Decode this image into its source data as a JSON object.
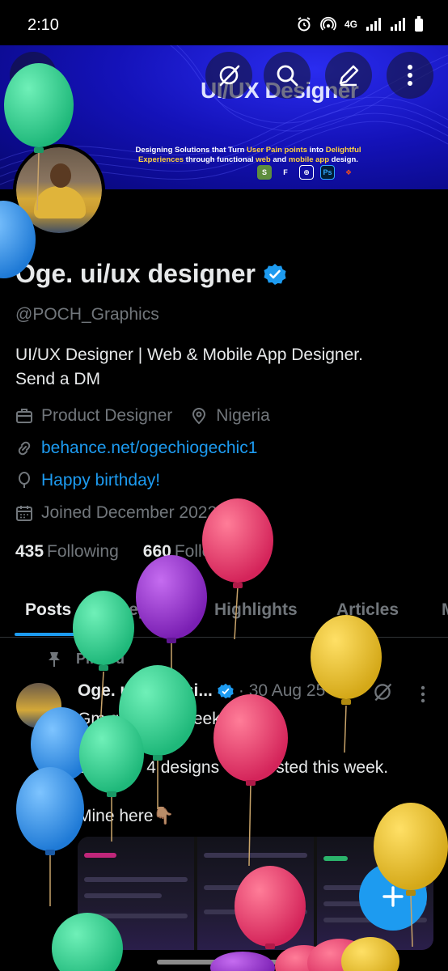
{
  "status_bar": {
    "time": "2:10",
    "network": "4G"
  },
  "banner": {
    "title": "UI/UX Designer",
    "subtitle_parts": [
      "Designing Solutions that Turn ",
      "User Pain points",
      " into ",
      "Delightful Experiences",
      " through functional ",
      "web",
      " and ",
      "mobile app",
      " design."
    ],
    "tools": [
      "Shopify",
      "Framer",
      "Fig",
      "Ps",
      "Figma"
    ],
    "tool_colors": [
      "#5e8e3e",
      "#ffffff",
      "#ffffff",
      "#31a8ff",
      "#f24e1e"
    ]
  },
  "profile": {
    "name": "Oge. ui/ux designer",
    "handle": "@POCH_Graphics",
    "bio_line1": "UI/UX Designer | Web & Mobile App Designer.",
    "bio_line2": "Send a DM",
    "category": "Product Designer",
    "location": "Nigeria",
    "website": "behance.net/ogechiogechic1",
    "birthday": "Happy birthday!",
    "joined": "Joined December 2022",
    "following_count": "435",
    "following_label": "Following",
    "followers_count": "660",
    "followers_label": "Followers"
  },
  "tabs": [
    "Posts",
    "Replies",
    "Highlights",
    "Articles"
  ],
  "active_tab": "Posts",
  "post": {
    "pinned_label": "Pinned",
    "author": "Oge. ui/ux desi...",
    "date": "· 30 Aug 25",
    "line1": "Gm guys, It's weekend.",
    "line2": "Lets see 4 designs You posted this week.",
    "line3": "Mine here👇🏽"
  },
  "colors": {
    "accent": "#1d9bf0",
    "muted": "#71767b",
    "text": "#e7e9ea",
    "background": "#000000"
  },
  "icons": [
    "back-arrow-icon",
    "grok-icon",
    "search-icon",
    "edit-icon",
    "more-vertical-icon",
    "verified-badge-icon",
    "briefcase-icon",
    "location-pin-icon",
    "link-icon",
    "balloon-icon",
    "calendar-icon",
    "pin-icon",
    "plus-icon"
  ]
}
